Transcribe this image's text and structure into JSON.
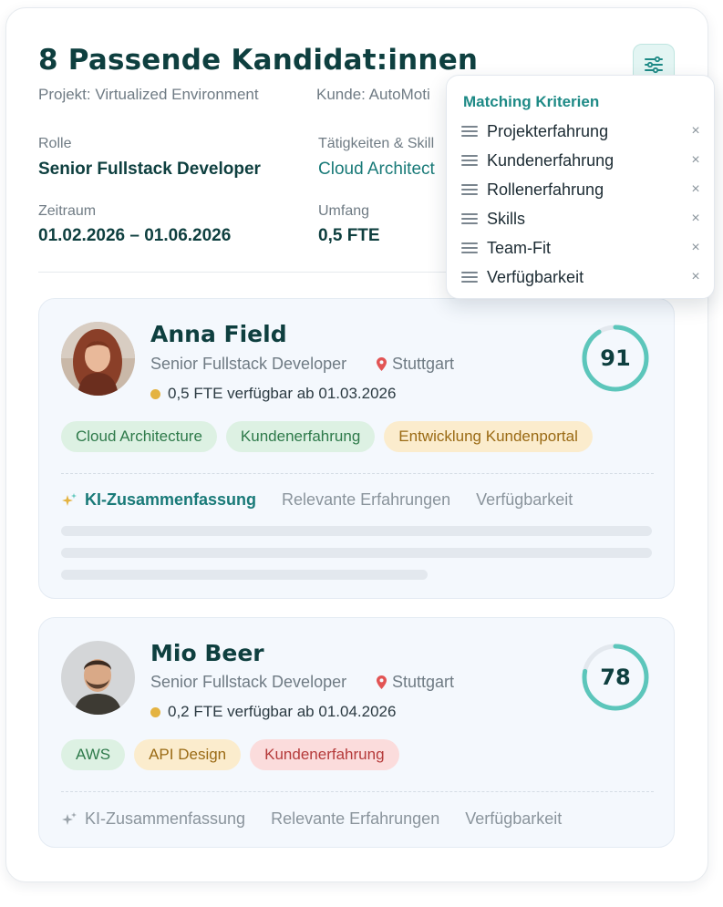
{
  "header": {
    "title": "8 Passende Kandidat:innen",
    "project": "Projekt: Virtualized Environment",
    "customer": "Kunde: AutoMoti"
  },
  "fields": {
    "role_label": "Rolle",
    "role_value": "Senior Fullstack Developer",
    "skills_label": "Tätigkeiten & Skill",
    "skills_value": "Cloud Architect",
    "period_label": "Zeitraum",
    "period_value": "01.02.2026 – 01.06.2026",
    "scope_label": "Umfang",
    "scope_value": "0,5 FTE"
  },
  "popover": {
    "title": "Matching Kriterien",
    "items": [
      {
        "label": "Projekterfahrung"
      },
      {
        "label": "Kundenerfahrung"
      },
      {
        "label": "Rollenerfahrung"
      },
      {
        "label": "Skills"
      },
      {
        "label": "Team-Fit"
      },
      {
        "label": "Verfügbarkeit"
      }
    ],
    "close_glyph": "×"
  },
  "candidates": [
    {
      "name": "Anna Field",
      "role": "Senior Fullstack Developer",
      "location": "Stuttgart",
      "availability": "0,5 FTE verfügbar ab 01.03.2026",
      "score": 91,
      "tags": [
        {
          "label": "Cloud Architecture",
          "tone": "green"
        },
        {
          "label": "Kundenerfahrung",
          "tone": "green"
        },
        {
          "label": "Entwicklung Kundenportal",
          "tone": "yellow"
        }
      ],
      "tabs": [
        "KI-Zusammenfassung",
        "Relevante Erfahrungen",
        "Verfügbarkeit"
      ],
      "active_tab": 0,
      "expanded": true
    },
    {
      "name": "Mio Beer",
      "role": "Senior Fullstack Developer",
      "location": "Stuttgart",
      "availability": "0,2 FTE verfügbar ab 01.04.2026",
      "score": 78,
      "tags": [
        {
          "label": "AWS",
          "tone": "green"
        },
        {
          "label": "API Design",
          "tone": "yellow"
        },
        {
          "label": "Kundenerfahrung",
          "tone": "red"
        }
      ],
      "tabs": [
        "KI-Zusammenfassung",
        "Relevante Erfahrungen",
        "Verfügbarkeit"
      ],
      "active_tab": -1,
      "expanded": false
    }
  ],
  "colors": {
    "brand_dark": "#0e3f3f",
    "accent_teal": "#5cc6bb",
    "ring_track": "#e3e8ee",
    "availability_dot": "#e4b341"
  },
  "icons": {
    "filter": "sliders-icon",
    "location": "map-pin-icon",
    "ai": "sparkle-icon",
    "drag": "drag-handle-icon",
    "close": "close-icon"
  }
}
